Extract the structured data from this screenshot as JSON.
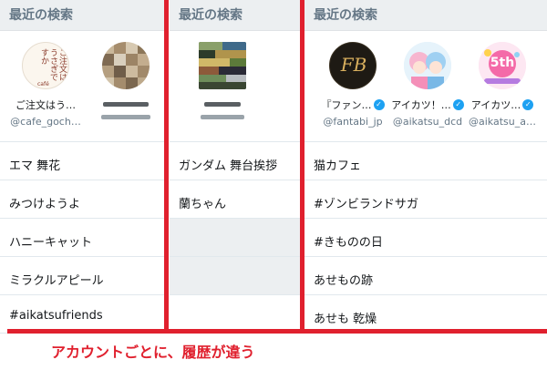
{
  "left_panel": {
    "header": "最近の検索",
    "users": [
      {
        "name": "ご注文はう…",
        "handle": "@cafe_goch…",
        "avatar_text": "ご注文はうさぎですか？？",
        "avatar_sub": "café"
      },
      {
        "name": "",
        "handle": ""
      }
    ],
    "items": [
      "エマ 舞花",
      "みつけようよ",
      "ハニーキャット",
      "ミラクルアピール",
      "#aikatsufriends"
    ]
  },
  "middle_panel": {
    "header": "最近の検索",
    "items": [
      "ガンダム 舞台挨拶",
      "蘭ちゃん",
      "",
      ""
    ]
  },
  "right_panel": {
    "header": "最近の検索",
    "users": [
      {
        "name": "『ファン…",
        "handle": "@fantabi_jp",
        "avatar_text": "FB",
        "verified": true
      },
      {
        "name": "アイカツ！…",
        "handle": "@aikatsu_dcd",
        "verified": true
      },
      {
        "name": "アイカツ…",
        "handle": "@aikatsu_a…",
        "avatar_text": "5th",
        "verified": true
      }
    ],
    "items": [
      "猫カフェ",
      "#ゾンビランドサガ",
      "#きものの日",
      "あせもの跡",
      "あせも 乾燥"
    ]
  },
  "caption": "アカウントごとに、履歴が違う",
  "colors": {
    "highlight": "#e0202e",
    "verified": "#1da1f2",
    "header_bg": "#eceff1"
  }
}
